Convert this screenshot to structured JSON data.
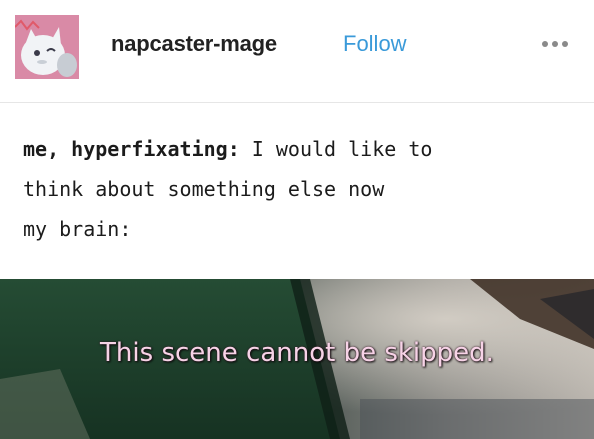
{
  "post": {
    "username": "napcaster-mage",
    "follow_label": "Follow",
    "more_icon": "more-options-icon"
  },
  "text": {
    "line1_speaker": "me, hyperfixating:",
    "line1_rest": " I would like to",
    "line2": "think about something else now",
    "line3": "my brain:"
  },
  "image": {
    "subtitle": "This scene cannot be skipped.",
    "subtitle_color": "#f7d3e7"
  },
  "colors": {
    "follow": "#3a9ad9",
    "avatar_bg": "#d98aa6"
  }
}
